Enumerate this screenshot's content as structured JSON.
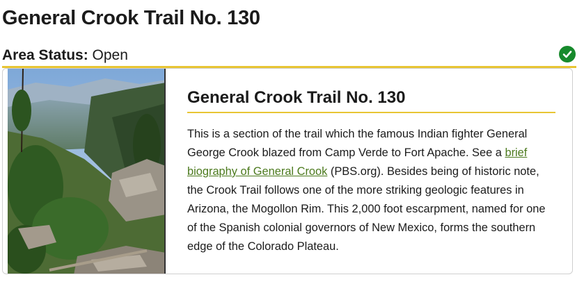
{
  "page": {
    "title": "General Crook Trail No. 130"
  },
  "status": {
    "label": "Area Status:",
    "value": "Open",
    "icon": "check-circle-icon",
    "icon_color": "#178a2c",
    "accent_color": "#e8c533"
  },
  "card": {
    "photo_icon": "mountain-landscape-photo",
    "title": "General Crook Trail No. 130",
    "description_before": "This is a section of the trail which the famous Indian fighter General George Crook blazed from Camp Verde to Fort Apache. See a ",
    "link_text": "brief biography of General Crook",
    "description_after": " (PBS.org). Besides being of historic note, the Crook Trail follows one of the more striking geologic features in Arizona, the Mogollon Rim. This 2,000 foot escarpment, named for one of the Spanish colonial governors of New Mexico, forms the southern edge of the Colorado Plateau.",
    "link_color": "#4c7a1e"
  }
}
